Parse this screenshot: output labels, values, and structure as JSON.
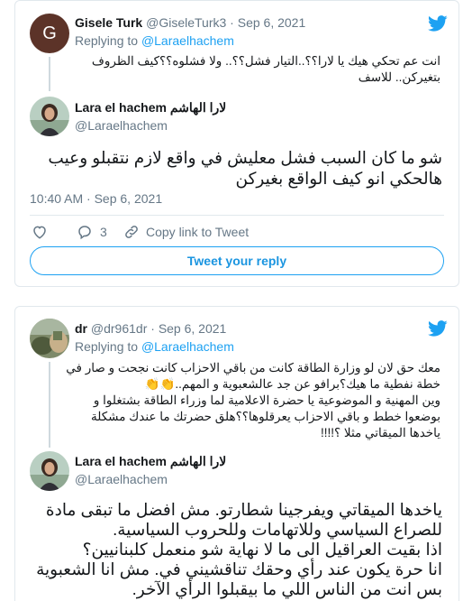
{
  "tweet1": {
    "author": {
      "name": "Gisele Turk",
      "handle": "@GiseleTurk3",
      "date": "Sep 6, 2021",
      "avatar_letter": "G"
    },
    "replying_prefix": "Replying to",
    "replying_to": "@Laraelhachem",
    "text_lines": [
      "انت عم تحكي هيك يا لارا؟؟..التيار فشل؟؟.. ولا فشلوه؟؟كيف الظروف",
      "بتغيركن.. للاسف"
    ]
  },
  "reply1": {
    "author": {
      "name": "Lara el hachem لارا الهاشم",
      "handle": "@Laraelhachem"
    },
    "text_lines": [
      "شو ما كان السبب فشل معليش في واقع لازم نتقبلو وعيب",
      "هالحكي انو كيف الواقع بغيركن"
    ],
    "timestamp": "10:40 AM · Sep 6, 2021",
    "actions": {
      "likes": "",
      "replies": "3",
      "copy_link": "Copy link to Tweet"
    },
    "reply_button": "Tweet your reply"
  },
  "tweet2": {
    "author": {
      "name": "dr",
      "handle": "@dr961dr",
      "date": "Sep 6, 2021"
    },
    "replying_prefix": "Replying to",
    "replying_to": "@Laraelhachem",
    "text_lines": [
      "معك حق لان لو وزارة الطاقة  كانت من باقي الاحزاب كانت نجحت و صار في",
      "خطة نفطية ما هيك؟برافو عن جد عالشعبوية و المهم..👏👏",
      " وين المهنية و الموضوعية يا حضرة الاعلامية لما وزراء الطاقة بشتغلوا و",
      "بوضعوا خطط و باقي الاحزاب يعرقلوها؟؟هلق حضرتك ما عندك مشكلة",
      "ياخدها الميقاتي مثلا ؟!!!!"
    ]
  },
  "reply2": {
    "author": {
      "name": "Lara el hachem لارا الهاشم",
      "handle": "@Laraelhachem"
    },
    "text_lines": [
      "ياخدها الميقاتي ويفرجينا شطارتو. مش افضل ما تبقى مادة",
      "للصراع السياسي وللاتهامات وللحروب السياسية.",
      "اذا  بقيت العراقيل الى ما لا نهاية شو منعمل كلبنانيين؟",
      "انا حرة يكون عند رأي وحقك تناقشيني في. مش انا الشعبوية",
      "بس انت من الناس اللي ما بيقبلوا الرأي الآخر."
    ]
  },
  "colors": {
    "twitter_blue": "#1da1f2",
    "secondary_text": "#657786",
    "border": "#e1e8ed",
    "avatar_g_bg": "#5c3328"
  }
}
